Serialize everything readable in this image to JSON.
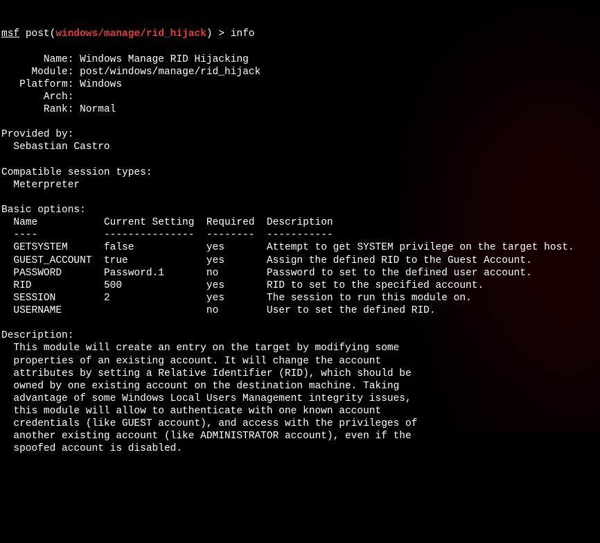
{
  "prompt": {
    "msf": "msf",
    "context": "post",
    "module": "windows/manage/rid_hijack",
    "command": "info"
  },
  "labels": {
    "name": "Name",
    "module": "Module",
    "platform": "Platform",
    "arch": "Arch",
    "rank": "Rank",
    "provided_by": "Provided by:",
    "session_types": "Compatible session types:",
    "basic_options": "Basic options:",
    "description": "Description:"
  },
  "info": {
    "name": "Windows Manage RID Hijacking",
    "module": "post/windows/manage/rid_hijack",
    "platform": "Windows",
    "arch": "",
    "rank": "Normal",
    "provided_by": "Sebastian Castro",
    "session_types": "Meterpreter"
  },
  "options": {
    "header": {
      "name": "Name",
      "current": "Current Setting",
      "required": "Required",
      "description": "Description"
    },
    "divider": {
      "c0": "----",
      "c1": "---------------",
      "c2": "--------",
      "c3": "-----------"
    },
    "rows": [
      {
        "name": "GETSYSTEM",
        "current": "false",
        "required": "yes",
        "description": "Attempt to get SYSTEM privilege on the target host."
      },
      {
        "name": "GUEST_ACCOUNT",
        "current": "true",
        "required": "yes",
        "description": "Assign the defined RID to the Guest Account."
      },
      {
        "name": "PASSWORD",
        "current": "Password.1",
        "required": "no",
        "description": "Password to set to the defined user account."
      },
      {
        "name": "RID",
        "current": "500",
        "required": "yes",
        "description": "RID to set to the specified account."
      },
      {
        "name": "SESSION",
        "current": "2",
        "required": "yes",
        "description": "The session to run this module on."
      },
      {
        "name": "USERNAME",
        "current": "",
        "required": "no",
        "description": "User to set the defined RID."
      }
    ]
  },
  "description": {
    "lines": [
      "This module will create an entry on the target by modifying some ",
      "properties of an existing account. It will change the account ",
      "attributes by setting a Relative Identifier (RID), which should be ",
      "owned by one existing account on the destination machine. Taking ",
      "advantage of some Windows Local Users Management integrity issues, ",
      "this module will allow to authenticate with one known account ",
      "credentials (like GUEST account), and access with the privileges of ",
      "another existing account (like ADMINISTRATOR account), even if the ",
      "spoofed account is disabled."
    ]
  }
}
